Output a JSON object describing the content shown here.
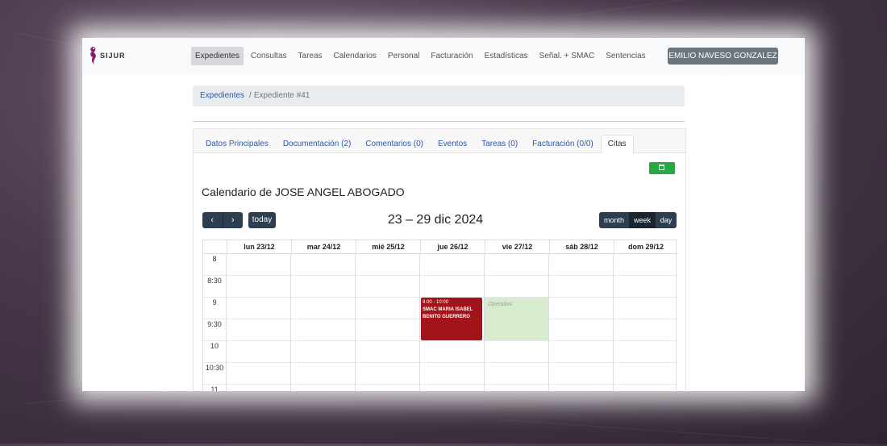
{
  "logo": {
    "text": "SIJUR",
    "color": "#8a1a6e"
  },
  "nav": {
    "items": [
      {
        "label": "Expedientes",
        "active": true
      },
      {
        "label": "Consultas"
      },
      {
        "label": "Tareas"
      },
      {
        "label": "Calendarios"
      },
      {
        "label": "Personal"
      },
      {
        "label": "Facturación"
      },
      {
        "label": "Estadísticas"
      },
      {
        "label": "Señal. + SMAC"
      },
      {
        "label": "Sentencias"
      }
    ],
    "user": "EMILIO NAVESO GONZALEZ"
  },
  "breadcrumb": {
    "link": "Expedientes",
    "separator": "/",
    "current": "Expediente #41"
  },
  "tabs": [
    {
      "label": "Datos Principales"
    },
    {
      "label": "Documentación (2)"
    },
    {
      "label": "Comentarios (0)"
    },
    {
      "label": "Eventos"
    },
    {
      "label": "Tareas (0)"
    },
    {
      "label": "Facturación (0/0)"
    },
    {
      "label": "Citas",
      "active": true
    }
  ],
  "calendar": {
    "title": "Calendario de JOSE ANGEL ABOGADO",
    "range": "23 – 29 dic 2024",
    "prev_icon": "chevron-left-icon",
    "next_icon": "chevron-right-icon",
    "today_label": "today",
    "views": [
      {
        "label": "month"
      },
      {
        "label": "week",
        "active": true
      },
      {
        "label": "day"
      }
    ],
    "days": [
      "lun 23/12",
      "mar 24/12",
      "mié 25/12",
      "jue 26/12",
      "vie 27/12",
      "sáb 28/12",
      "dom 29/12"
    ],
    "times": [
      "8",
      "8:30",
      "9",
      "9:30",
      "10",
      "10:30",
      "11"
    ],
    "events": [
      {
        "time": "9:00 - 10:00",
        "title": "SMAC MARIA ISABEL BENITO GUERRERO",
        "color": "#a0141a"
      }
    ],
    "background_events": [
      {
        "label": "Operativo",
        "color": "#d7ebcf"
      }
    ]
  },
  "colors": {
    "accent_dark": "#2c3e50",
    "success": "#28a745",
    "link": "#2b59a8"
  }
}
